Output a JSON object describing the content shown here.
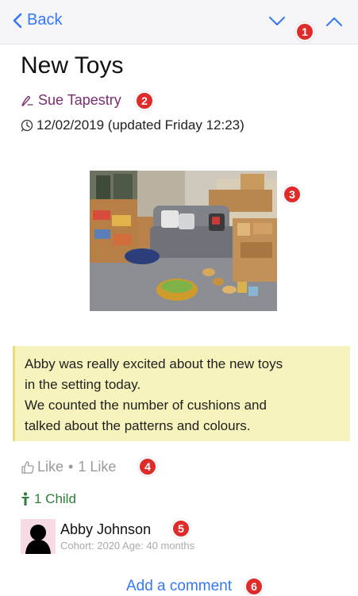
{
  "nav": {
    "back_label": "Back"
  },
  "post": {
    "title": "New Toys",
    "author": "Sue Tapestry",
    "date": "12/02/2019 (updated Friday 12:23)",
    "note_lines": [
      "Abby was really excited about the new toys",
      "in the setting today.",
      "We counted the number of cushions and",
      "talked about the patterns and colours."
    ]
  },
  "likes": {
    "like_label": "Like",
    "separator": "•",
    "count_label": "1 Like"
  },
  "children": {
    "label": "1 Child",
    "list": [
      {
        "name": "Abby Johnson",
        "meta": "Cohort: 2020 Age: 40 months"
      }
    ]
  },
  "comment": {
    "label": "Add a comment"
  },
  "badges": [
    "1",
    "2",
    "3",
    "4",
    "5",
    "6"
  ],
  "colors": {
    "accent": "#3478f6",
    "author": "#7a2e6f",
    "child_green": "#2f7d3a",
    "badge": "#e02b2b",
    "note_bg": "#f7f3bd"
  },
  "icons": {
    "back": "chevron-left-icon",
    "down": "chevron-down-icon",
    "up": "chevron-up-icon",
    "author": "pen-icon",
    "date": "clock-icon",
    "like": "thumbs-up-icon",
    "child": "person-icon"
  }
}
